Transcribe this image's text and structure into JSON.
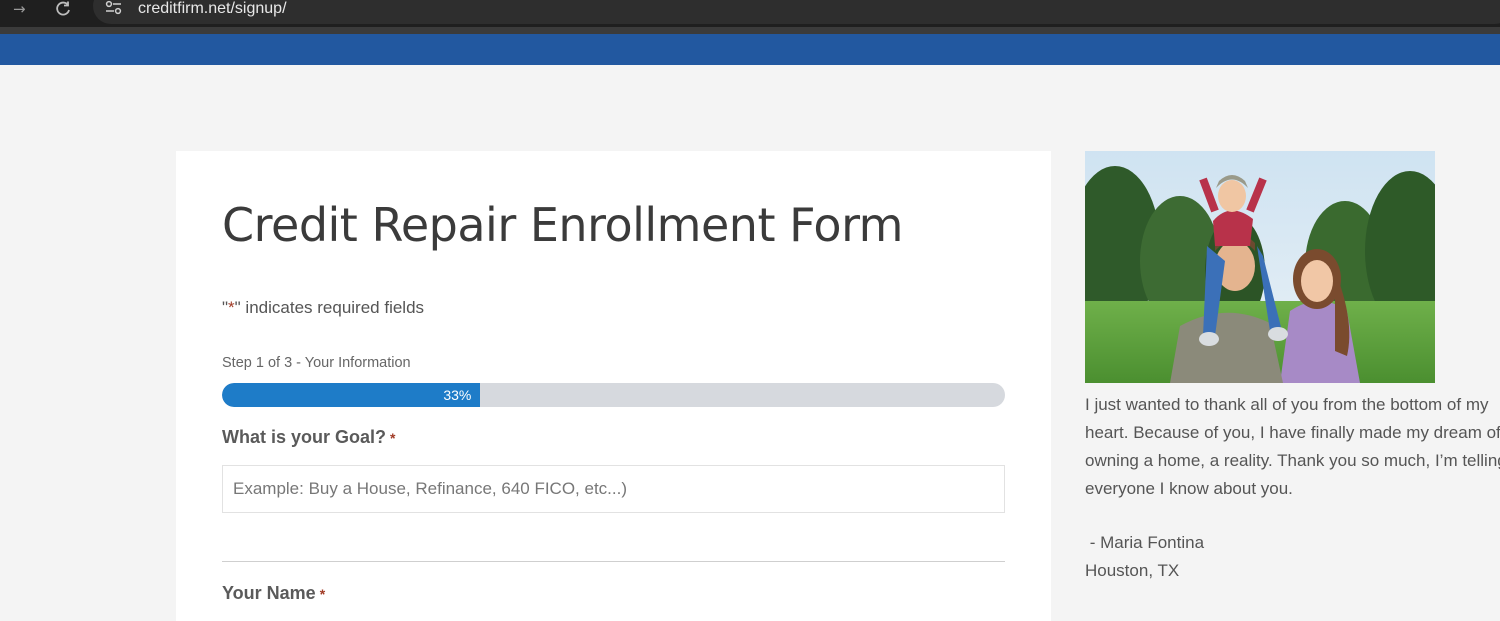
{
  "browser": {
    "url": "creditfirm.net/signup/",
    "forward_icon": "arrow-right-icon",
    "reload_icon": "reload-icon",
    "site_info_icon": "tune-icon"
  },
  "colors": {
    "header_blue": "#2258a0",
    "progress_blue": "#1e7cc8",
    "required_star": "#a13b26"
  },
  "form": {
    "title": "Credit Repair Enrollment Form",
    "required_quote_open": "\"",
    "required_star": "*",
    "required_note_rest": "\" indicates required fields",
    "step_label": "Step 1 of 3 - Your Information",
    "progress_percent": 33,
    "progress_text": "33%",
    "goal_label": "What is your Goal?",
    "goal_required": "*",
    "goal_placeholder": "Example: Buy a House, Refinance, 640 FICO, etc...)",
    "name_label": "Your Name",
    "name_required": "*"
  },
  "testimonial": {
    "photo_icon": "family-photo",
    "text": "I just wanted to thank all of you from the bottom of my heart. Because of you, I have finally made my dream of owning a home, a reality. Thank you so much, I’m telling everyone I know about you.",
    "author": " - Maria Fontina",
    "location": "Houston, TX"
  }
}
